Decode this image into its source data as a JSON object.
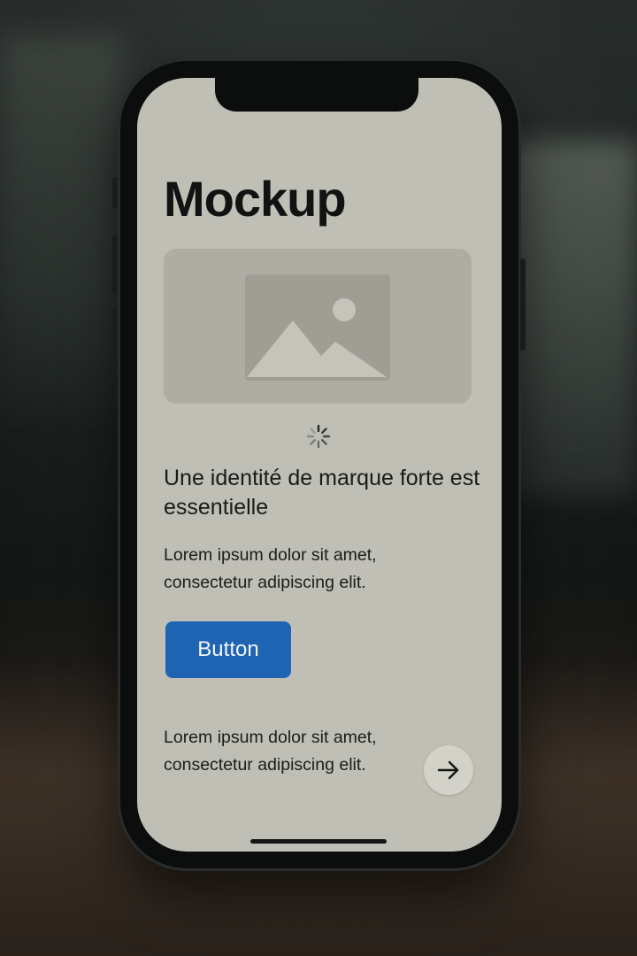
{
  "screen": {
    "title": "Mockup",
    "image_placeholder": "image-placeholder-icon",
    "loading": "loading-spinner-icon",
    "heading": "Une identité de marque forte est essentielle",
    "body_text_1": "Lorem ipsum dolor sit amet, consectetur adipiscing elit.",
    "button_label": "Button",
    "body_text_2": "Lorem ipsum dolor sit amet, consectetur adipiscing elit.",
    "next_icon": "arrow-right-icon"
  },
  "colors": {
    "screen_background": "#bfbfb5",
    "button": "#1f64b3",
    "phone_frame": "#0c0d0d"
  }
}
